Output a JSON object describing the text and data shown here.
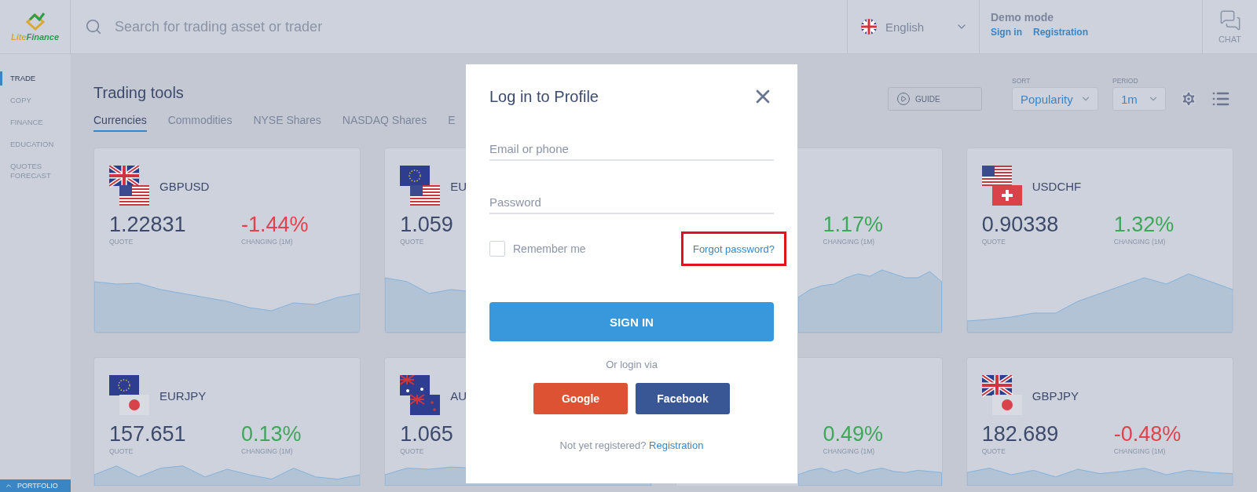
{
  "logo": {
    "brand": [
      "Lite",
      "Finance"
    ]
  },
  "search": {
    "placeholder": "Search for trading asset or trader"
  },
  "language": {
    "value": "English"
  },
  "account": {
    "mode": "Demo mode",
    "links": [
      "Sign in",
      "Registration"
    ]
  },
  "chat": {
    "label": "CHAT"
  },
  "sidebar": {
    "items": [
      {
        "label": "TRADE",
        "selected": true
      },
      {
        "label": "COPY",
        "selected": false
      },
      {
        "label": "FINANCE",
        "selected": false
      },
      {
        "label": "EDUCATION",
        "selected": false
      },
      {
        "label": "QUOTES FORECAST",
        "selected": false
      }
    ],
    "portfolio": "PORTFOLIO"
  },
  "section": {
    "title": "Trading tools",
    "tabs": [
      {
        "label": "Currencies",
        "selected": true
      },
      {
        "label": "Commodities",
        "selected": false
      },
      {
        "label": "NYSE Shares",
        "selected": false
      },
      {
        "label": "NASDAQ Shares",
        "selected": false
      },
      {
        "label": "E",
        "selected": false
      }
    ],
    "guide": "GUIDE",
    "sort": {
      "label": "SORT",
      "value": "Popularity"
    },
    "period": {
      "label": "PERIOD",
      "value": "1m"
    }
  },
  "cards": [
    {
      "pair": "GBPUSD",
      "quote": "1.22831",
      "quote_label": "QUOTE",
      "change": "-1.44%",
      "change_label": "CHANGING (1M)",
      "color": "#e0434b"
    },
    {
      "pair": "EU",
      "quote": "1.059",
      "quote_label": "QUOTE"
    },
    {
      "change": "1.17%",
      "change_label": "CHANGING (1M)",
      "color": "#3ea75a"
    },
    {
      "pair": "USDCHF",
      "quote": "0.90338",
      "quote_label": "QUOTE",
      "change": "1.32%",
      "change_label": "CHANGING (1M)",
      "color": "#3ea75a"
    },
    {
      "pair": "EURJPY",
      "quote": "157.651",
      "quote_label": "QUOTE",
      "change": "0.13%",
      "change_label": "CHANGING (1M)",
      "color": "#3ea75a"
    },
    {
      "pair": "AU",
      "quote": "1.065",
      "quote_label": "QUOTE"
    },
    {
      "change": "0.49%",
      "change_label": "CHANGING (1M)",
      "color": "#3ea75a"
    },
    {
      "pair": "GBPJPY",
      "quote": "182.689",
      "quote_label": "QUOTE",
      "change": "-0.48%",
      "change_label": "CHANGING (1M)",
      "color": "#e0434b"
    }
  ],
  "modal": {
    "title": "Log in to Profile",
    "fields": [
      {
        "placeholder": "Email or phone"
      },
      {
        "placeholder": "Password"
      }
    ],
    "remember": {
      "label": "Remember me",
      "checked": false
    },
    "forgot": {
      "label": "Forgot password?",
      "highlighted": true
    },
    "submit": "SIGN IN",
    "alt_text": "Or login via",
    "social": [
      {
        "label": "Google",
        "color": "#dc5232"
      },
      {
        "label": "Facebook",
        "color": "#3a5795"
      }
    ],
    "footer": {
      "text": "Not yet registered?",
      "link": "Registration"
    }
  }
}
